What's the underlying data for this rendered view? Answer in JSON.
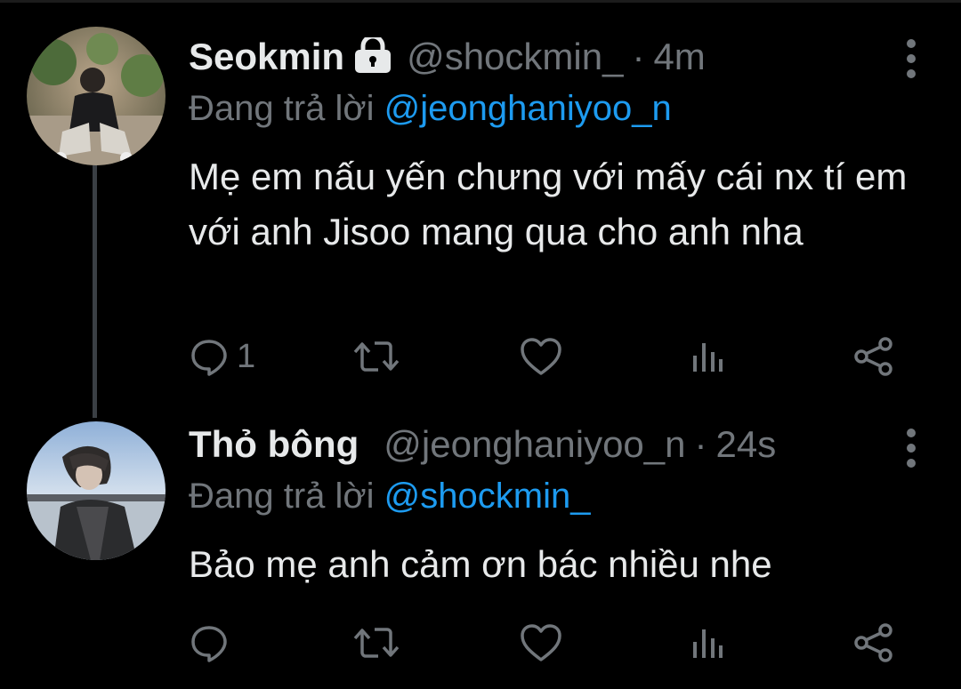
{
  "tweets": [
    {
      "display_name": "Seokmin",
      "protected": true,
      "handle": "@shockmin_",
      "separator": "·",
      "time": "4m",
      "reply_prefix": "Đang trả lời",
      "reply_to": "@jeonghaniyoo_n",
      "text": "Mẹ em nấu yến chưng với mấy cái nx tí em với anh Jisoo mang qua cho anh nha",
      "reply_count": "1"
    },
    {
      "display_name": "Thỏ bông",
      "protected": false,
      "handle": "@jeonghaniyoo_n",
      "separator": "·",
      "time": "24s",
      "reply_prefix": "Đang trả lời",
      "reply_to": "@shockmin_",
      "text": "Bảo mẹ anh cảm ơn bác nhiều nhe",
      "reply_count": ""
    }
  ],
  "colors": {
    "background": "#000000",
    "text": "#e7e9ea",
    "muted": "#71767b",
    "accent": "#1d9bf0",
    "thread_line": "#3a3f44"
  },
  "icons": [
    "lock-icon",
    "more-icon",
    "reply-icon",
    "retweet-icon",
    "like-icon",
    "analytics-icon",
    "share-icon"
  ]
}
